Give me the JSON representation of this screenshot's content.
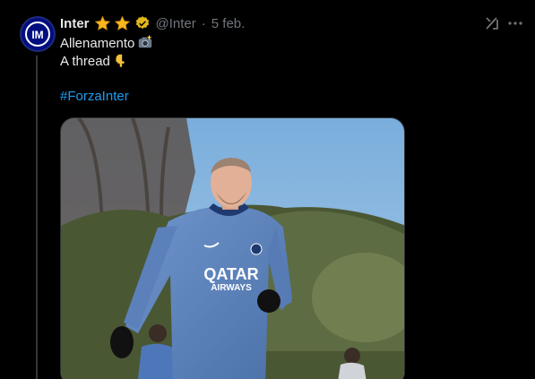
{
  "tweet": {
    "author_name": "Inter",
    "handle": "@Inter",
    "separator": "·",
    "date": "5 feb.",
    "line1": "Allenamento",
    "line2": "A thread",
    "hashtag": "#ForzaInter",
    "icons": {
      "star": "star-emoji",
      "verified": "verified-gold-badge",
      "camera": "camera-flash-emoji",
      "pointing_down": "backhand-index-pointing-down-emoji",
      "grok": "grok-icon",
      "more": "more-horizontal-icon"
    },
    "media": {
      "description_colors": {
        "sky": "#7fb3e0",
        "kit": "#5f86bf",
        "trees": "#4d5a3a"
      },
      "shirt_sponsor_line1": "QATAR",
      "shirt_sponsor_line2": "AIRWAYS"
    }
  },
  "colors": {
    "background": "#000000",
    "text": "#e7e9ea",
    "muted": "#71767b",
    "link": "#1d9bf0",
    "badge_gold": "#e2b719"
  }
}
